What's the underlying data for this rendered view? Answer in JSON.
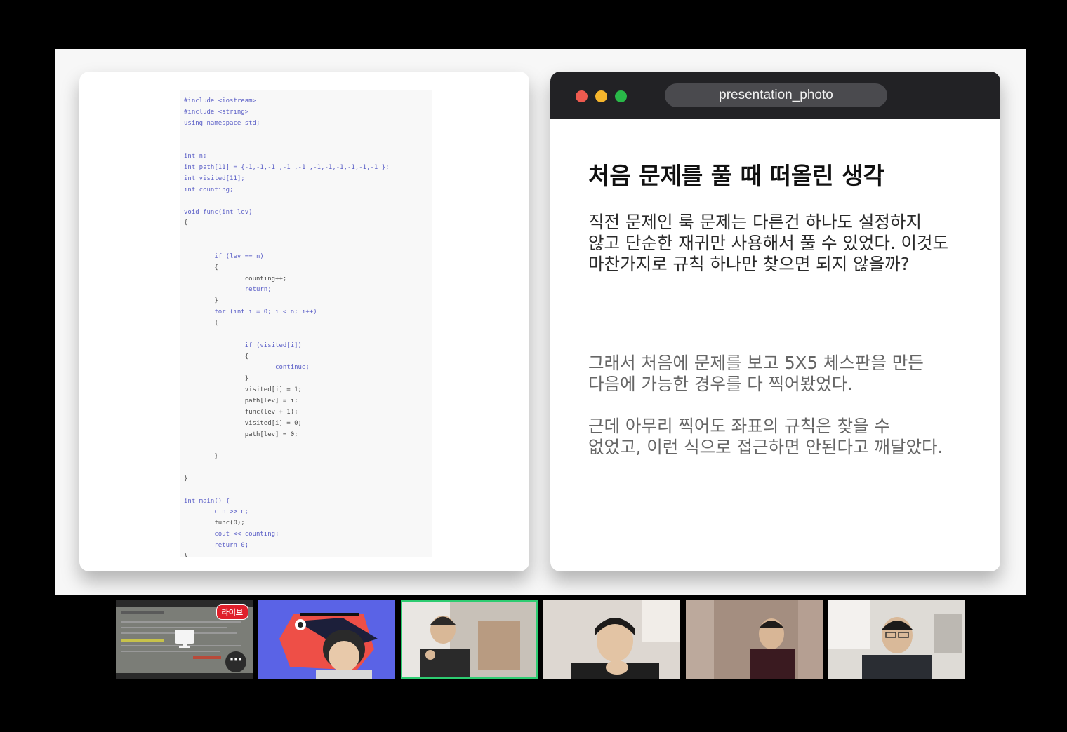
{
  "app": {
    "name": "video-meeting-screen-share"
  },
  "slide": {
    "code_lines": [
      "#include <iostream>",
      "#include <string>",
      "using namespace std;",
      "",
      "",
      "int n;",
      "int path[11] = {-1,-1,-1 ,-1 ,-1 ,-1,-1,-1,-1,-1,-1 };",
      "int visited[11];",
      "int counting;",
      "",
      "void func(int lev)",
      "{",
      "",
      "",
      "        if (lev == n)",
      "        {",
      "                counting++;",
      "                return;",
      "        }",
      "        for (int i = 0; i < n; i++)",
      "        {",
      "",
      "                if (visited[i])",
      "                {",
      "                        continue;",
      "                }",
      "                visited[i] = 1;",
      "                path[lev] = i;",
      "                func(lev + 1);",
      "                visited[i] = 0;",
      "                path[lev] = 0;",
      "",
      "        }",
      "",
      "}",
      "",
      "int main() {",
      "        cin >> n;",
      "        func(0);",
      "        cout << counting;",
      "        return 0;",
      "}"
    ],
    "window": {
      "title": "presentation_photo",
      "heading": "처음 문제를 풀 때 떠올린 생각",
      "para1": [
        "직전 문제인 룩 문제는 다른건 하나도 설정하지",
        "않고 단순한 재귀만 사용해서 풀 수 있었다. 이것도",
        "마찬가지로 규칙 하나만 찾으면 되지 않을까?"
      ],
      "para2": [
        "그래서 처음에 문제를 보고 5X5  체스판을 만든",
        "다음에 가능한 경우를 다 찍어봤었다."
      ],
      "para3": [
        "근데 아무리 찍어도 좌표의 규칙은 찾을 수",
        "없었고, 이런 식으로 접근하면 안된다고 깨달았다."
      ]
    }
  },
  "participants": {
    "live_badge": "라이브",
    "more_label": "⋯",
    "tiles": [
      {
        "name": "screen-share-tile",
        "selected": false
      },
      {
        "name": "participant-2",
        "selected": false
      },
      {
        "name": "participant-3",
        "selected": true
      },
      {
        "name": "participant-4",
        "selected": false
      },
      {
        "name": "participant-5",
        "selected": false
      },
      {
        "name": "participant-6",
        "selected": false
      }
    ]
  },
  "colors": {
    "selected_outline": "#2ecc71",
    "live_badge": "#e0202b"
  }
}
